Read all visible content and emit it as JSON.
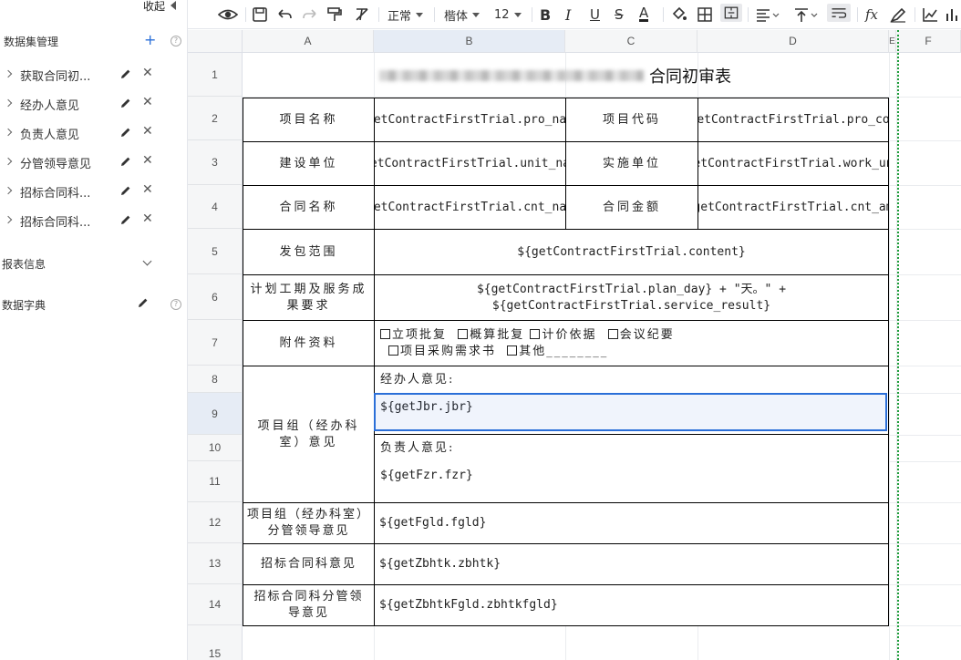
{
  "sidebar": {
    "collapse_label": "收起",
    "dataset_header": "数据集管理",
    "datasets": [
      {
        "label": "获取合同初..."
      },
      {
        "label": "经办人意见"
      },
      {
        "label": "负责人意见"
      },
      {
        "label": "分管领导意见"
      },
      {
        "label": "招标合同科..."
      },
      {
        "label": "招标合同科..."
      }
    ],
    "report_info": "报表信息",
    "data_dict": "数据字典"
  },
  "toolbar": {
    "style_value": "正常",
    "font_value": "楷体",
    "size_value": "12"
  },
  "columns": [
    "A",
    "B",
    "C",
    "D",
    "E",
    "F"
  ],
  "rows": [
    "1",
    "2",
    "3",
    "4",
    "5",
    "6",
    "7",
    "8",
    "9",
    "10",
    "11",
    "12",
    "13",
    "14",
    "15"
  ],
  "report": {
    "title_suffix": "合同初审表",
    "r2": {
      "a": "项目名称",
      "b": "${getContractFirstTrial.pro_name}",
      "c": "项目代码",
      "d": "${getContractFirstTrial.pro_code}"
    },
    "r3": {
      "a": "建设单位",
      "b": "${getContractFirstTrial.unit_name}",
      "c": "实施单位",
      "d": "${getContractFirstTrial.work_unit}"
    },
    "r4": {
      "a": "合同名称",
      "b": "${getContractFirstTrial.cnt_name}",
      "c": "合同金额",
      "d": "${getContractFirstTrial.cnt_amt}"
    },
    "r5": {
      "a": "发包范围",
      "b": "${getContractFirstTrial.content}"
    },
    "r6": {
      "a": "计划工期及服务成果要求",
      "b": "${getContractFirstTrial.plan_day} + \"天。\" + ${getContractFirstTrial.service_result}"
    },
    "r7": {
      "a": "附件资料",
      "line1": [
        "立项批复",
        "概算批复",
        "计价依据",
        "会议纪要"
      ],
      "line2": [
        "项目采购需求书",
        "其他________"
      ]
    },
    "r8_11": {
      "a": "项目组（经办科室）意见",
      "jbr_label": "经办人意见:",
      "jbr_value": "${getJbr.jbr}",
      "fzr_label": "负责人意见:",
      "fzr_value": "${getFzr.fzr}"
    },
    "r12": {
      "a": "项目组（经办科室）分管领导意见",
      "b": "${getFgld.fgld}"
    },
    "r13": {
      "a": "招标合同科意见",
      "b": "${getZbhtk.zbhtk}"
    },
    "r14": {
      "a": "招标合同科分管领导意见",
      "b": "${getZbhtkFgld.zbhtkfgld}"
    }
  }
}
